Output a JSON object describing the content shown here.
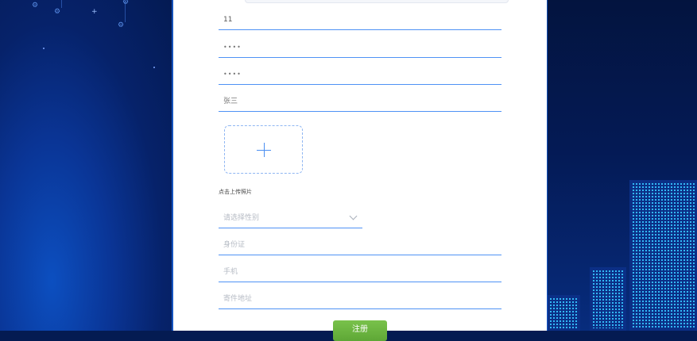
{
  "form": {
    "username_value": "11",
    "password_mask": "••••",
    "confirm_password_mask": "••••",
    "real_name_value": "张三",
    "upload_label": "点击上传照片",
    "gender_placeholder": "请选择性别",
    "id_card_placeholder": "身份证",
    "phone_placeholder": "手机",
    "address_placeholder": "寄件地址",
    "submit_label": "注册"
  },
  "colors": {
    "accent": "#4e92f5",
    "submit": "#6cb33f",
    "background": "#041b52"
  },
  "icons": {
    "upload": "plus-icon",
    "gender_dropdown": "chevron-down-icon"
  }
}
